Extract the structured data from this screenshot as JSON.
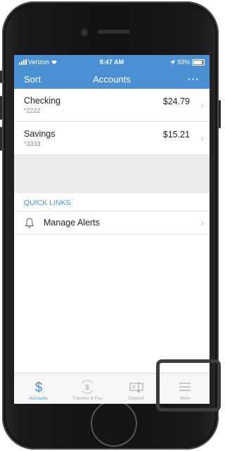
{
  "status_bar": {
    "carrier": "Verizon",
    "time": "8:47 AM",
    "battery": "93%"
  },
  "nav": {
    "left_label": "Sort",
    "title": "Accounts",
    "menu_icon": "ellipsis-icon"
  },
  "accounts": [
    {
      "name": "Checking",
      "number": "*2222",
      "balance": "$24.79"
    },
    {
      "name": "Savings",
      "number": "*3333",
      "balance": "$15.21"
    }
  ],
  "quick_links": {
    "header": "QUICK LINKS",
    "items": [
      {
        "label": "Manage Alerts",
        "icon": "bell-icon"
      }
    ]
  },
  "tabs": [
    {
      "label": "Accounts",
      "icon": "dollar-icon",
      "active": true
    },
    {
      "label": "Transfer & Pay",
      "icon": "transfer-dollar-icon",
      "active": false
    },
    {
      "label": "Deposit",
      "icon": "check-deposit-icon",
      "active": false
    },
    {
      "label": "More",
      "icon": "hamburger-icon",
      "active": false
    }
  ],
  "colors": {
    "accent": "#4a90d2",
    "highlight": "#3c3c3c"
  }
}
